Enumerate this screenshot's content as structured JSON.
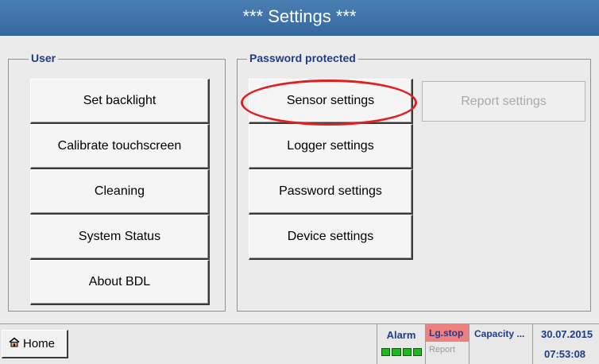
{
  "header": {
    "title": "***  Settings  ***"
  },
  "user_group": {
    "legend": "User",
    "buttons": [
      "Set backlight",
      "Calibrate touchscreen",
      "Cleaning",
      "System Status",
      "About BDL"
    ]
  },
  "password_group": {
    "legend": "Password protected",
    "buttons": [
      "Sensor settings",
      "Logger settings",
      "Password settings",
      "Device settings"
    ],
    "report_button": "Report settings"
  },
  "footer": {
    "home_label": "Home",
    "alarm_label": "Alarm",
    "logger_status": "Lg.stop",
    "report_label": "Report",
    "capacity_label": "Capacity ...",
    "date": "30.07.2015",
    "time": "07:53:08"
  },
  "colors": {
    "header_bg": "#3d72a8",
    "legend_text": "#1f3b8c",
    "highlight_ring": "#e02020",
    "logger_status_bg": "#f07f7f",
    "alarm_ok": "#22b522"
  },
  "icons": {
    "home": "home-icon"
  }
}
